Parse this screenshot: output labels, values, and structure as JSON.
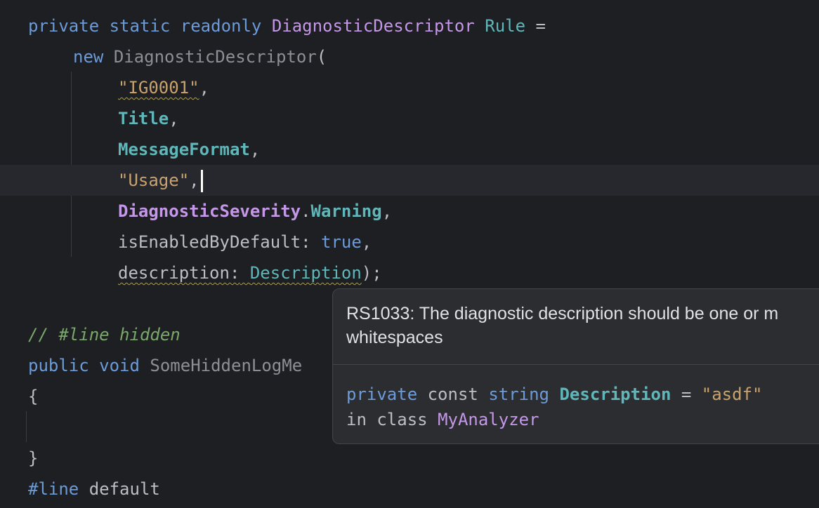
{
  "code": {
    "line1": {
      "kw_private": "private",
      "kw_static": "static",
      "kw_readonly": "readonly",
      "type": "DiagnosticDescriptor",
      "name": "Rule",
      "eq": " ="
    },
    "line2": {
      "kw_new": "new",
      "ctor": "DiagnosticDescriptor",
      "paren": "("
    },
    "line3": {
      "id_literal": "\"IG0001\"",
      "comma": ","
    },
    "line4": {
      "ident": "Title",
      "comma": ","
    },
    "line5": {
      "ident": "MessageFormat",
      "comma": ","
    },
    "line6": {
      "category_literal": "\"Usage\"",
      "comma": ","
    },
    "line7": {
      "severity_type": "DiagnosticSeverity",
      "dot": ".",
      "severity_value": "Warning",
      "comma": ","
    },
    "line8": {
      "param": "isEnabledByDefault:",
      "value": "true",
      "comma": ","
    },
    "line9": {
      "param": "description:",
      "space": " ",
      "value": "Description",
      "close": ");"
    },
    "line11": {
      "comment": "// #line hidden"
    },
    "line12": {
      "kw_public": "public",
      "kw_void": "void",
      "method": "SomeHiddenLogMe"
    },
    "line13": {
      "brace": "{"
    },
    "line15": {
      "brace": "}"
    },
    "line16": {
      "directive": "#line",
      "arg": "default"
    }
  },
  "tooltip": {
    "message_line1": "RS1033: The diagnostic description should be one or m",
    "message_line2": "whitespaces",
    "decl": {
      "kw_private": "private",
      "kw_const": "const",
      "kw_string": "string",
      "name": "Description",
      "eq": "=",
      "value": "\"asdf\"",
      "in": "in",
      "kw_class": "class",
      "class_name": "MyAnalyzer"
    }
  },
  "colors": {
    "background": "#1e1f22",
    "keyword": "#6b9bd9",
    "type": "#c597e8",
    "field": "#5fb7ba",
    "string": "#c9a26d",
    "comment": "#79a86b",
    "warning_underline": "#b8a229",
    "tooltip_background": "#2b2d30"
  }
}
